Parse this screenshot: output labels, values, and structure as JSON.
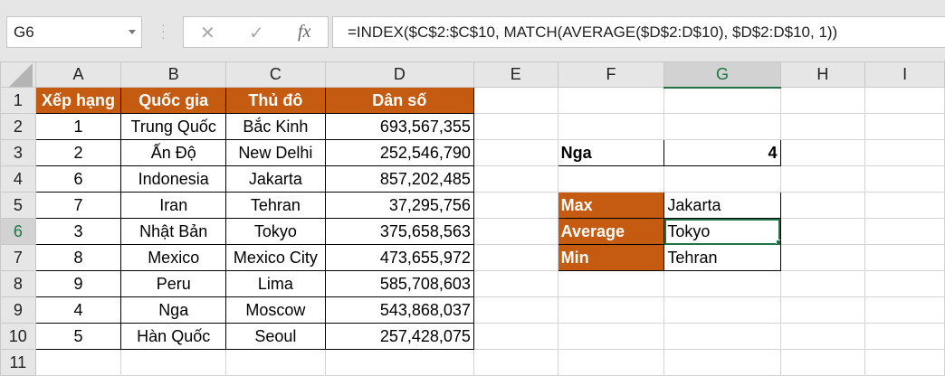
{
  "name_box": "G6",
  "formula_bar": {
    "cancel_icon": "✕",
    "enter_icon": "✓",
    "fx_label": "fx",
    "formula": "=INDEX($C$2:$C$10, MATCH(AVERAGE($D$2:D$10), $D$2:D$10, 1))"
  },
  "columns": [
    "A",
    "B",
    "C",
    "D",
    "E",
    "F",
    "G",
    "H",
    "I"
  ],
  "rows": [
    "1",
    "2",
    "3",
    "4",
    "5",
    "6",
    "7",
    "8",
    "9",
    "10",
    "11"
  ],
  "table": {
    "headers": [
      "Xếp hạng",
      "Quốc gia",
      "Thủ đô",
      "Dân số"
    ],
    "data": [
      [
        "1",
        "Trung Quốc",
        "Bắc Kinh",
        "693,567,355"
      ],
      [
        "2",
        "Ấn Độ",
        "New Delhi",
        "252,546,790"
      ],
      [
        "6",
        "Indonesia",
        "Jakarta",
        "857,202,485"
      ],
      [
        "7",
        "Iran",
        "Tehran",
        "37,295,756"
      ],
      [
        "3",
        "Nhật Bản",
        "Tokyo",
        "375,658,563"
      ],
      [
        "8",
        "Mexico",
        "Mexico City",
        "473,655,972"
      ],
      [
        "9",
        "Peru",
        "Lima",
        "585,708,603"
      ],
      [
        "4",
        "Nga",
        "Moscow",
        "543,868,037"
      ],
      [
        "5",
        "Hàn Quốc",
        "Seoul",
        "257,428,075"
      ]
    ]
  },
  "lookup": {
    "label": "Nga",
    "value": "4"
  },
  "summary": [
    {
      "label": "Max",
      "value": "Jakarta"
    },
    {
      "label": "Average",
      "value": "Tokyo"
    },
    {
      "label": "Min",
      "value": "Tehran"
    }
  ],
  "colors": {
    "header_fill": "#c55a11",
    "selection": "#217346"
  }
}
